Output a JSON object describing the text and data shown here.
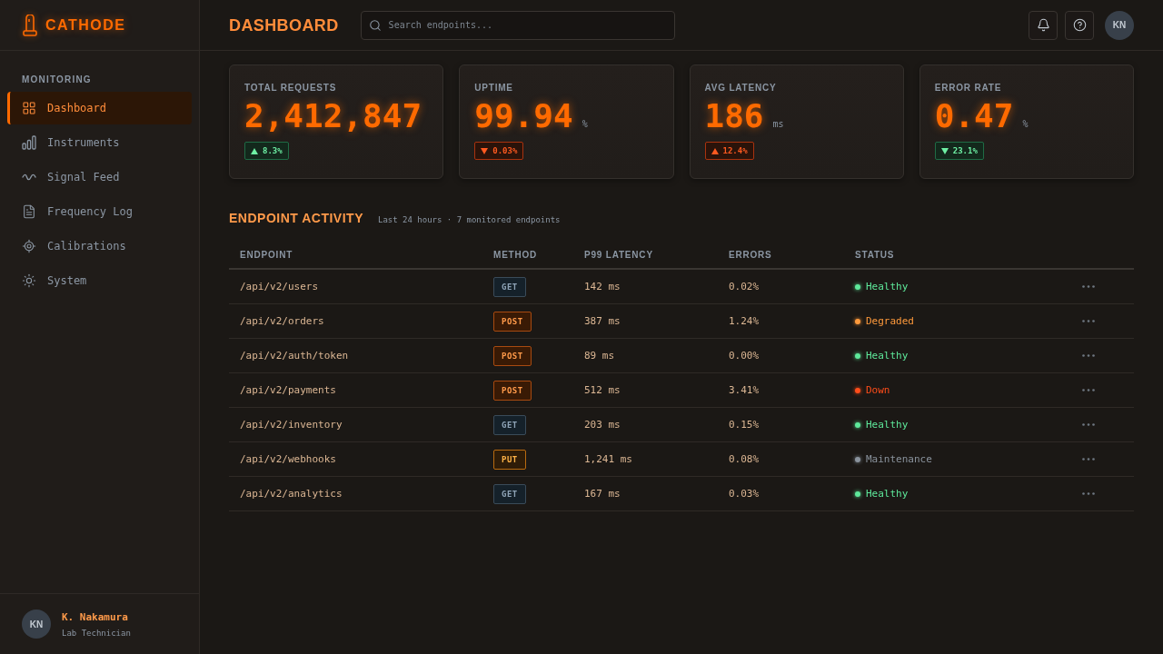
{
  "sidebar": {
    "brand": "CATHODE",
    "section_label": "MONITORING",
    "items": [
      {
        "label": "Dashboard",
        "selected": true
      },
      {
        "label": "Instruments",
        "selected": false
      },
      {
        "label": "Signal Feed",
        "selected": false
      },
      {
        "label": "Frequency Log",
        "selected": false
      },
      {
        "label": "Calibrations",
        "selected": false
      },
      {
        "label": "System",
        "selected": false
      }
    ],
    "user": {
      "initials": "KN",
      "name": "K. Nakamura",
      "role": "Lab Technician"
    }
  },
  "header": {
    "title": "DASHBOARD",
    "search": {
      "placeholder": "Search endpoints..."
    },
    "avatar": "KN"
  },
  "stats": [
    {
      "label": "TOTAL REQUESTS",
      "value": "2,412,847",
      "delta": {
        "text": "8.3%",
        "rising": true,
        "good": true
      }
    },
    {
      "label": "UPTIME",
      "value": "99.94",
      "unit": "%",
      "delta": {
        "text": "0.03%",
        "rising": false,
        "good": false
      }
    },
    {
      "label": "AVG LATENCY",
      "value": "186",
      "unit": "ms",
      "delta": {
        "text": "12.4%",
        "rising": true,
        "good": false
      }
    },
    {
      "label": "ERROR RATE",
      "value": "0.47",
      "unit": "%",
      "delta": {
        "text": "23.1%",
        "rising": false,
        "good": true
      }
    }
  ],
  "activity": {
    "title": "ENDPOINT ACTIVITY",
    "subtitle": "Last 24 hours · 7 monitored endpoints",
    "table": {
      "columns": [
        "ENDPOINT",
        "METHOD",
        "P99 LATENCY",
        "ERRORS",
        "STATUS"
      ],
      "rows": [
        {
          "endpoint": "/api/v2/users",
          "method": {
            "text": "GET",
            "kind": "get"
          },
          "latency": "142 ms",
          "errors": "0.02%",
          "status": {
            "label": "Healthy",
            "color": "#5ee89a"
          }
        },
        {
          "endpoint": "/api/v2/orders",
          "method": {
            "text": "POST",
            "kind": "post"
          },
          "latency": "387 ms",
          "errors": "1.24%",
          "status": {
            "label": "Degraded",
            "color": "#ff9a3c"
          }
        },
        {
          "endpoint": "/api/v2/auth/token",
          "method": {
            "text": "POST",
            "kind": "post"
          },
          "latency": "89 ms",
          "errors": "0.00%",
          "status": {
            "label": "Healthy",
            "color": "#5ee89a"
          }
        },
        {
          "endpoint": "/api/v2/payments",
          "method": {
            "text": "POST",
            "kind": "post"
          },
          "latency": "512 ms",
          "errors": "3.41%",
          "status": {
            "label": "Down",
            "color": "#ff4d1a"
          }
        },
        {
          "endpoint": "/api/v2/inventory",
          "method": {
            "text": "GET",
            "kind": "get"
          },
          "latency": "203 ms",
          "errors": "0.15%",
          "status": {
            "label": "Healthy",
            "color": "#5ee89a"
          }
        },
        {
          "endpoint": "/api/v2/webhooks",
          "method": {
            "text": "PUT",
            "kind": "put"
          },
          "latency": "1,241 ms",
          "errors": "0.08%",
          "status": {
            "label": "Maintenance",
            "color": "#8a939d"
          }
        },
        {
          "endpoint": "/api/v2/analytics",
          "method": {
            "text": "GET",
            "kind": "get"
          },
          "latency": "167 ms",
          "errors": "0.03%",
          "status": {
            "label": "Healthy",
            "color": "#5ee89a"
          }
        }
      ]
    }
  }
}
